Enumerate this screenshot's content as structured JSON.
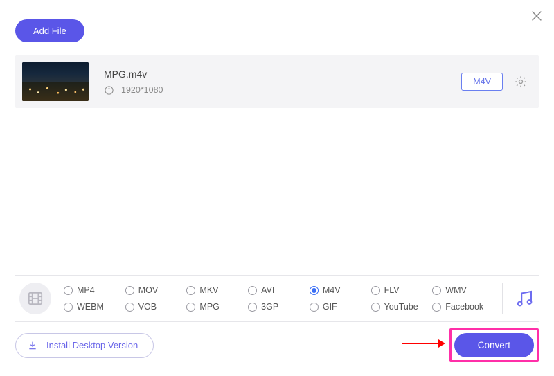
{
  "header": {
    "add_file_label": "Add File"
  },
  "file": {
    "name": "MPG.m4v",
    "resolution": "1920*1080",
    "output_format": "M4V"
  },
  "formats": {
    "selected": "M4V",
    "row1": [
      "MP4",
      "MOV",
      "MKV",
      "AVI",
      "M4V",
      "FLV",
      "WMV"
    ],
    "row2": [
      "WEBM",
      "VOB",
      "MPG",
      "3GP",
      "GIF",
      "YouTube",
      "Facebook"
    ]
  },
  "footer": {
    "install_label": "Install Desktop Version",
    "convert_label": "Convert"
  }
}
